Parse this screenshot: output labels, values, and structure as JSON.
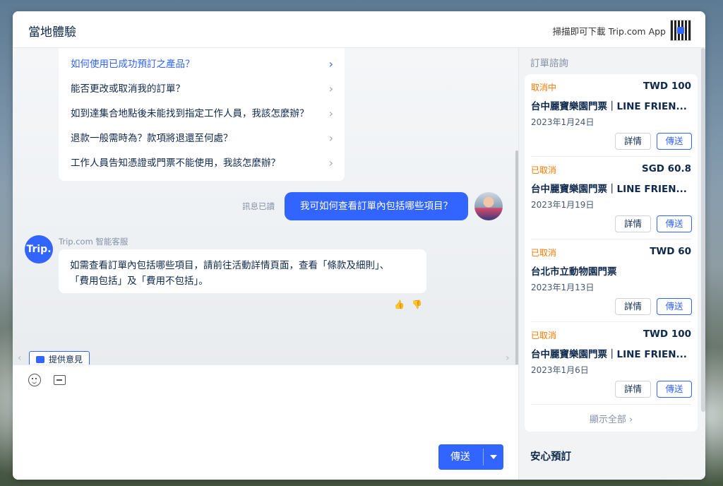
{
  "header": {
    "title": "當地體驗",
    "qr_text": "掃描即可下載 Trip.com App"
  },
  "faq": {
    "items": [
      {
        "label": "如何使用已成功預訂之產品？"
      },
      {
        "label": "能否更改或取消我的訂單？"
      },
      {
        "label": "如到達集合地點後未能找到指定工作人員，我該怎麼辦？"
      },
      {
        "label": "退款一般需時為？款項將退還至何處？"
      },
      {
        "label": "工作人員告知憑證或門票不能使用，我該怎麼辦？"
      }
    ]
  },
  "chat": {
    "read_label": "訊息已讀",
    "user_message": "我可如何查看訂單內包括哪些項目？",
    "bot_avatar_text": "Trip.",
    "bot_name": "Trip.com 智能客服",
    "bot_message_line1": "如需查看訂單內包括哪些項目，請前往活動詳情頁面，查看「條款及細則」、",
    "bot_message_line2": "「費用包括」及「費用不包括」。",
    "feedback_label": "提供意見"
  },
  "composer": {
    "send_label": "傳送"
  },
  "sidebar": {
    "title": "訂單諮詢",
    "orders": [
      {
        "status": "取消中",
        "price": "TWD 100",
        "name": "台中麗寶樂園門票｜LINE FRIEN...",
        "date": "2023年1月24日",
        "detail_label": "詳情",
        "send_label": "傳送"
      },
      {
        "status": "已取消",
        "price": "SGD 60.8",
        "name": "台中麗寶樂園門票｜LINE FRIEN...",
        "date": "2023年1月19日",
        "detail_label": "詳情",
        "send_label": "傳送"
      },
      {
        "status": "已取消",
        "price": "TWD 60",
        "name": "台北市立動物園門票",
        "date": "2023年1月13日",
        "detail_label": "詳情",
        "send_label": "傳送"
      },
      {
        "status": "已取消",
        "price": "TWD 100",
        "name": "台中麗寶樂園門票｜LINE FRIEN...",
        "date": "2023年1月6日",
        "detail_label": "詳情",
        "send_label": "傳送"
      }
    ],
    "show_all": "顯示全部",
    "section_title": "安心預訂"
  },
  "colors": {
    "accent": "#3264ff",
    "status_orange": "#ff7700",
    "text_primary": "#0f294d"
  }
}
